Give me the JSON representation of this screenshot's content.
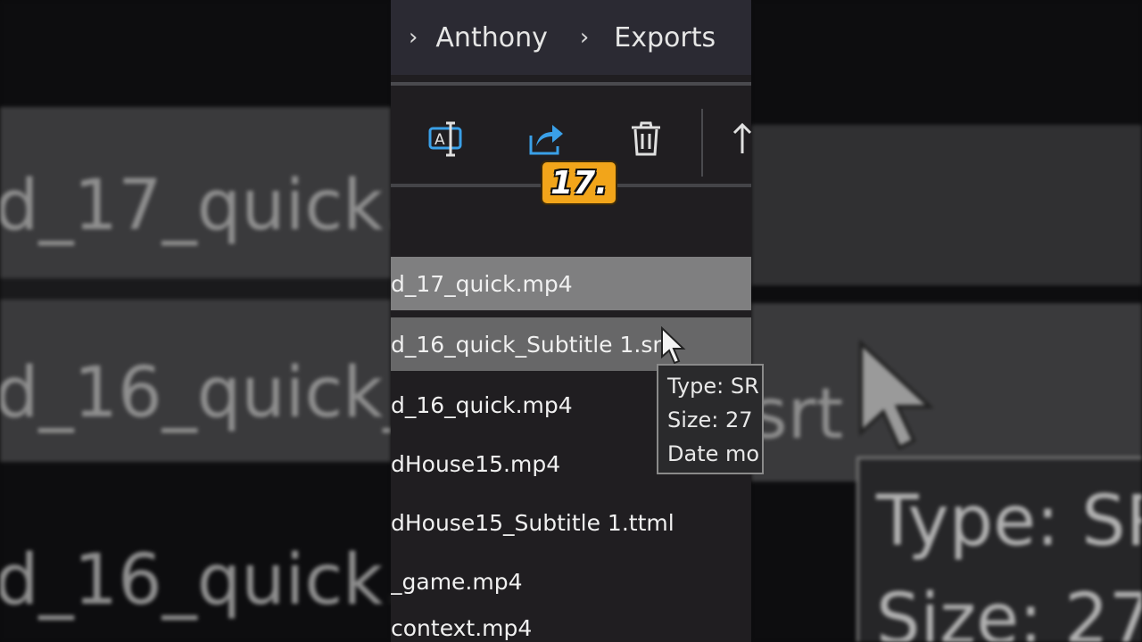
{
  "breadcrumb": {
    "items": [
      "Anthony",
      "Exports"
    ]
  },
  "toolbar": {
    "buttons": [
      "rename",
      "share",
      "delete",
      "sort"
    ]
  },
  "overlay": {
    "badge_text": "17."
  },
  "files": [
    {
      "name": "d_17_quick.mp4",
      "state": "selected"
    },
    {
      "name": "d_16_quick_Subtitle 1.srt",
      "state": "hover"
    },
    {
      "name": "d_16_quick.mp4",
      "state": "normal"
    },
    {
      "name": "dHouse15.mp4",
      "state": "normal"
    },
    {
      "name": "dHouse15_Subtitle 1.ttml",
      "state": "normal"
    },
    {
      "name": "_game.mp4",
      "state": "normal"
    },
    {
      "name": "context.mp4",
      "state": "normal"
    }
  ],
  "tooltip": {
    "lines": [
      "Type: SR",
      "Size: 27",
      "Date mo"
    ]
  },
  "blur_text": {
    "left": [
      "d_17_quick.m",
      "d_16_quick_",
      "d_16_quick.m"
    ],
    "right": [
      "srt",
      "Type: SR",
      "Size: 27"
    ]
  },
  "colors": {
    "accent_icon": "#3aa0e8",
    "badge": "#f2a51a",
    "selected_row": "#7f7f80"
  }
}
